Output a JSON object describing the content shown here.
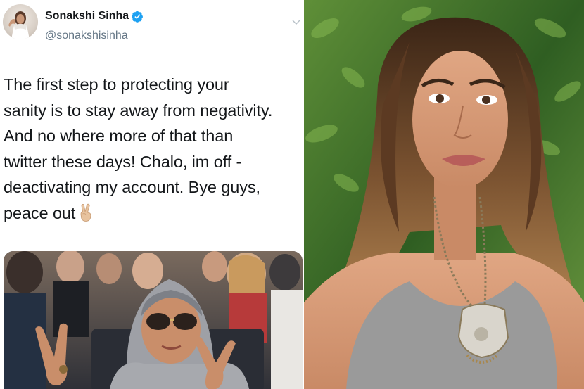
{
  "tweet": {
    "display_name": "Sonakshi Sinha",
    "handle": "@sonakshisinha",
    "verified_icon": "verified-badge-icon",
    "more_icon": "chevron-down-icon",
    "lines": [
      "The first step to protecting your",
      "sanity is to stay away from negativity.",
      "And no where more of that than",
      "twitter these days! Chalo, im off -",
      "deactivating my account. Bye guys,",
      "peace out"
    ],
    "emoji": "victory-hand-emoji",
    "media": "peace-sign-gif"
  },
  "photo": {
    "subject": "selfie-photo"
  },
  "colors": {
    "text": "#14171a",
    "secondary": "#657786",
    "verified_blue": "#1da1f2"
  }
}
